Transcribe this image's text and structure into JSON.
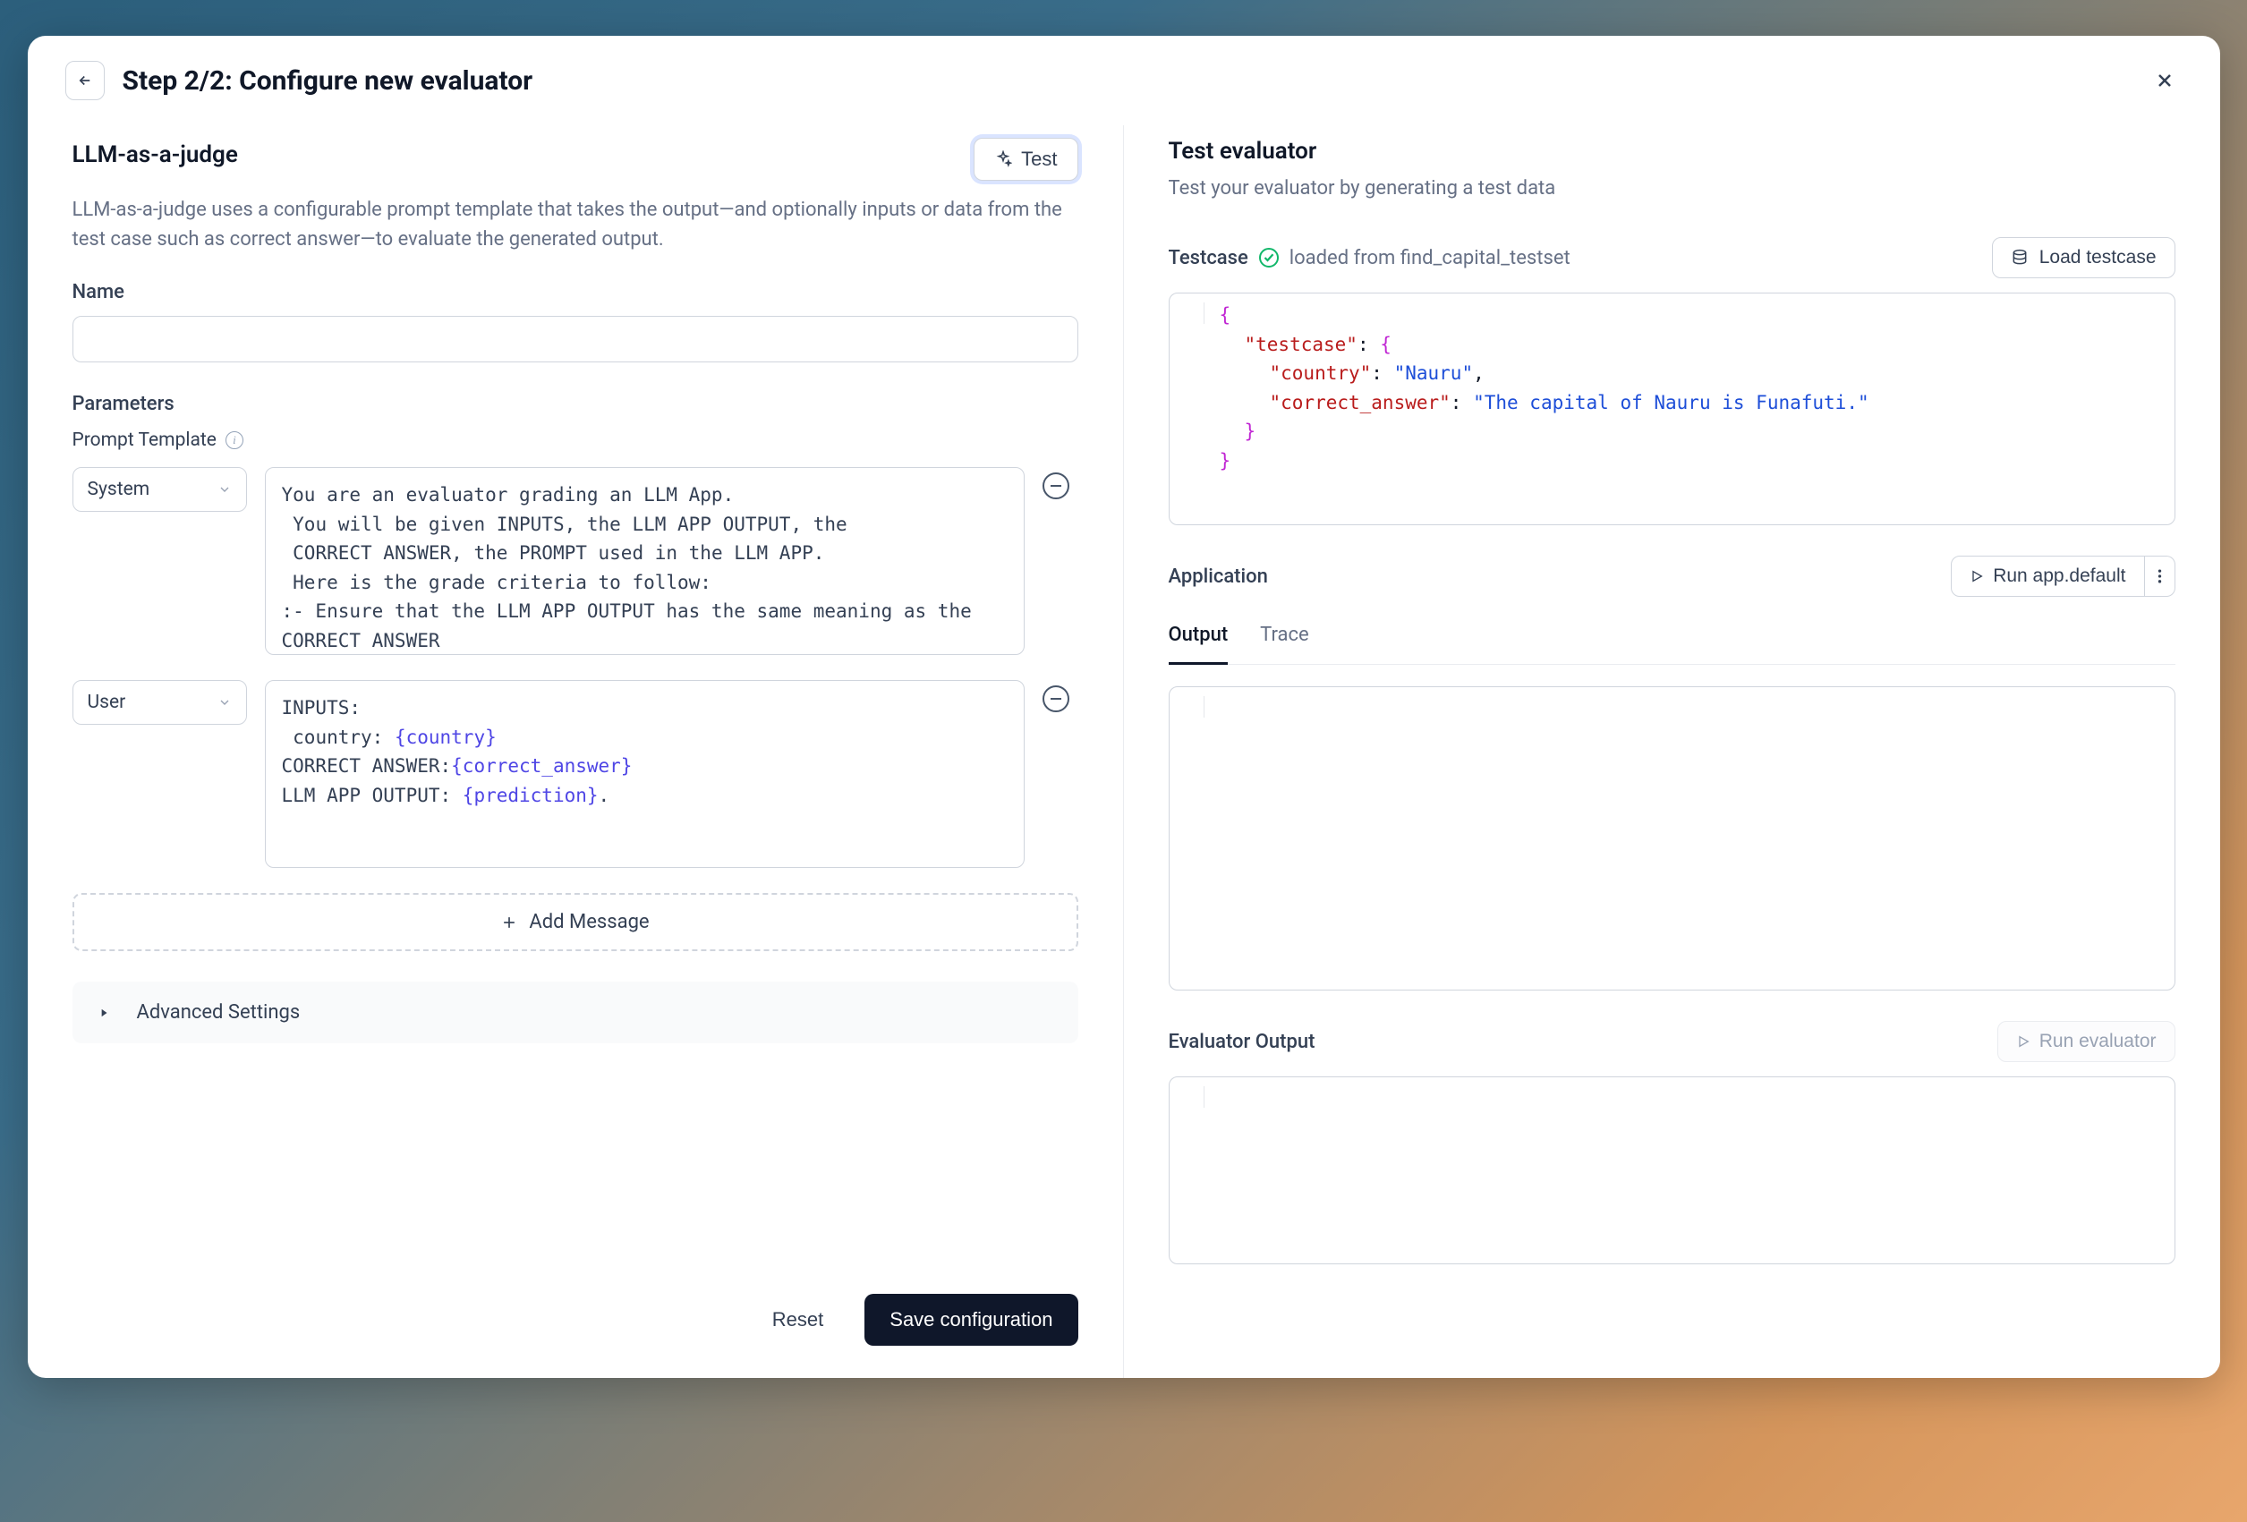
{
  "header": {
    "step_title": "Step 2/2:  Configure new evaluator"
  },
  "left": {
    "title": "LLM-as-a-judge",
    "test_button": "Test",
    "description": "LLM-as-a-judge uses a configurable prompt template that takes the output—and optionally inputs or data from the test case such as correct answer—to evaluate the generated output.",
    "name_label": "Name",
    "name_value": "",
    "parameters_label": "Parameters",
    "prompt_template_label": "Prompt Template",
    "messages": [
      {
        "role": "System",
        "body_plain": "You are an evaluator grading an LLM App.\n You will be given INPUTS, the LLM APP OUTPUT, the\n CORRECT ANSWER, the PROMPT used in the LLM APP.\n Here is the grade criteria to follow:\n:- Ensure that the LLM APP OUTPUT has the same meaning as the CORRECT ANSWER"
      },
      {
        "role": "User",
        "body_parts": [
          {
            "t": "text",
            "v": "INPUTS:\n country: "
          },
          {
            "t": "var",
            "v": "{country}"
          },
          {
            "t": "text",
            "v": "\nCORRECT ANSWER:"
          },
          {
            "t": "var",
            "v": "{correct_answer}"
          },
          {
            "t": "text",
            "v": "\nLLM APP OUTPUT: "
          },
          {
            "t": "var",
            "v": "{prediction}"
          },
          {
            "t": "text",
            "v": "."
          }
        ]
      }
    ],
    "add_message": "Add Message",
    "advanced": "Advanced Settings",
    "reset": "Reset",
    "save": "Save configuration"
  },
  "right": {
    "title": "Test evaluator",
    "subtitle": "Test your evaluator by generating a test data",
    "testcase_label": "Testcase",
    "testcase_loaded_from": "loaded from find_capital_testset",
    "load_testcase": "Load testcase",
    "testcase_json": {
      "testcase": {
        "country": "Nauru",
        "correct_answer": "The capital of Nauru is Funafuti."
      }
    },
    "application_label": "Application",
    "run_app": "Run app.default",
    "tabs": {
      "output": "Output",
      "trace": "Trace"
    },
    "evaluator_output_label": "Evaluator Output",
    "run_evaluator": "Run evaluator"
  }
}
